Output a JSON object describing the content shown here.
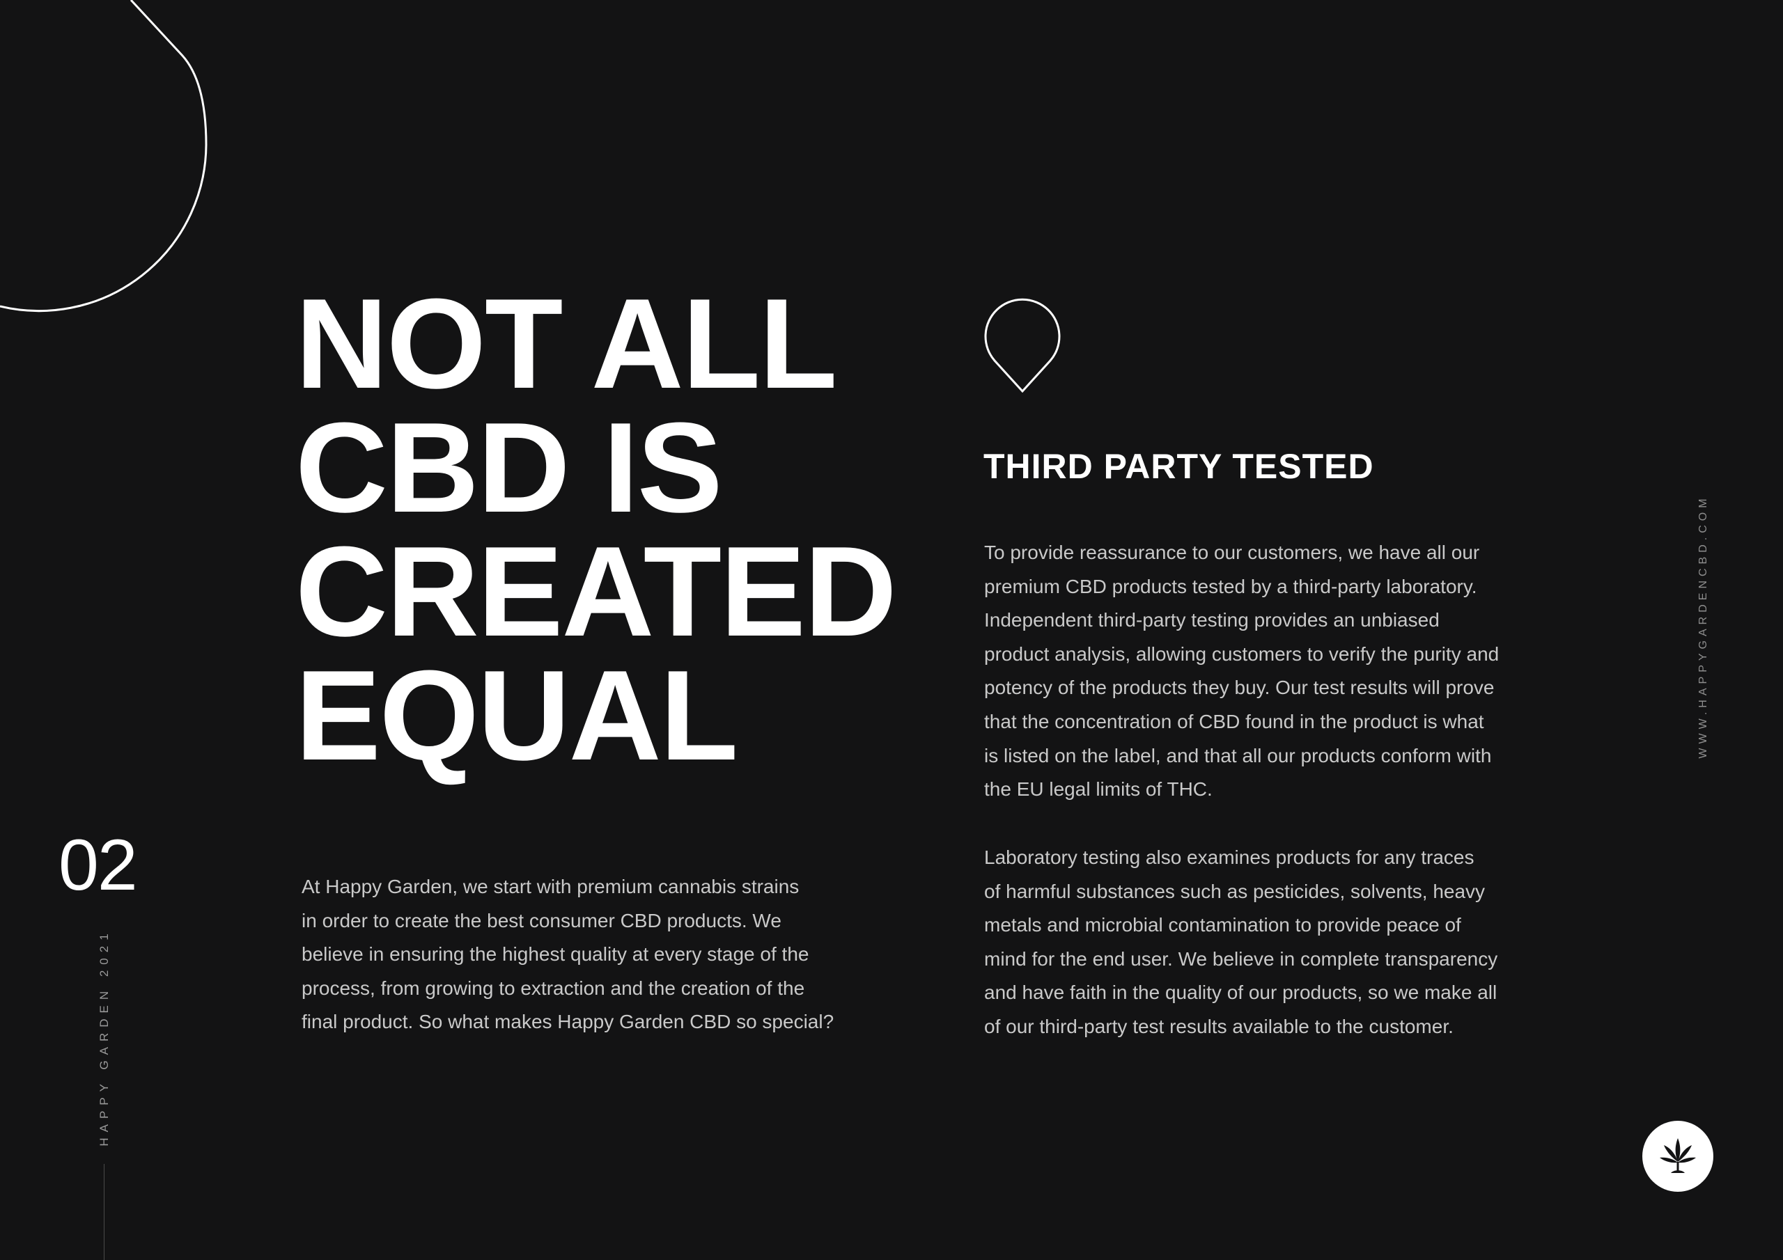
{
  "headline": {
    "lines": [
      "NOT ALL",
      "CBD IS",
      "CREATED",
      "EQUAL"
    ]
  },
  "page_number": "02",
  "footer_left": "HAPPY GARDEN 2021",
  "intro": {
    "lines": [
      "At Happy Garden, we start with premium cannabis strains",
      "in order to create the best consumer CBD products. We",
      "believe in ensuring the highest quality at every stage of the",
      "process, from growing to extraction and the creation of the",
      "final product. So what makes Happy Garden CBD so special?"
    ]
  },
  "section": {
    "icon": "map-pin-icon",
    "title": "THIRD PARTY TESTED",
    "paragraph1": [
      "To provide reassurance to our customers, we have all our",
      "premium CBD products tested by a third-party laboratory.",
      "Independent third-party testing provides an unbiased",
      "product analysis, allowing customers to verify the purity and",
      "potency of the products they buy. Our test results will prove",
      "that the concentration of CBD found in the product is what",
      "is listed on the label, and that all our products conform with",
      "the EU legal limits of THC."
    ],
    "paragraph2": [
      "Laboratory testing also examines products for any traces",
      "of harmful substances such as pesticides, solvents, heavy",
      "metals and microbial contamination to provide peace of",
      "mind for the end user. We believe in complete transparency",
      "and have faith in the quality of our products, so we make all",
      "of our third-party test results available to the customer."
    ]
  },
  "website": "WWW.HAPPYGARDENCBD.COM",
  "logo": {
    "icon": "cannabis-leaf-icon"
  },
  "colors": {
    "background": "#131314",
    "text": "#ffffff",
    "body_text": "#c9c9c9",
    "muted": "#9a9a9a"
  }
}
